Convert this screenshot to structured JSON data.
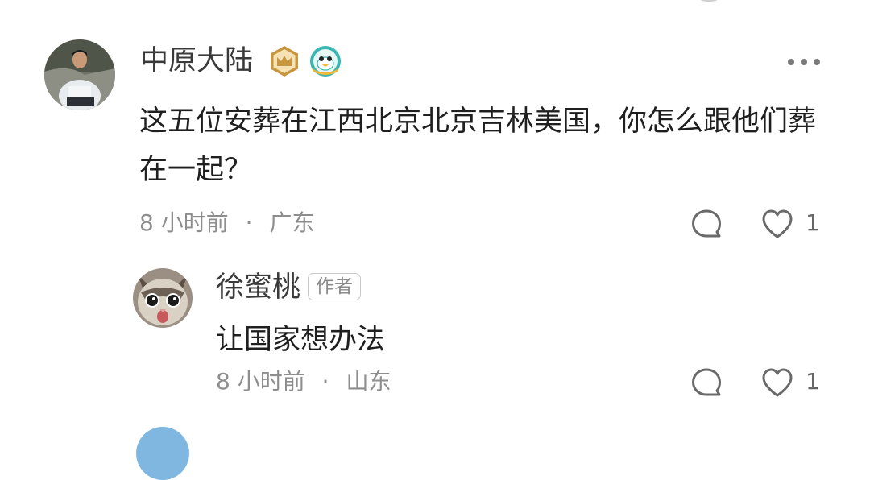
{
  "comments": [
    {
      "user_name": "中原大陆",
      "text": "这五位安葬在江西北京北京吉林美国，你怎么跟他们葬在一起？",
      "time": "8 小时前",
      "location": "广东",
      "likes": "1"
    }
  ],
  "replies": [
    {
      "user_name": "徐蜜桃",
      "badge": "作者",
      "text": "让国家想办法",
      "time": "8 小时前",
      "location": "山东",
      "likes": "1"
    }
  ],
  "meta_separator": "·",
  "colors": {
    "meta_text": "#8e8e8e",
    "badge_gold": "#c8963e",
    "badge_teal": "#3cb6b0",
    "next_avatar": "#7fb7e0"
  },
  "icons": [
    "more-options-icon",
    "comment-bubble-icon",
    "heart-icon",
    "crown-badge-icon",
    "bird-badge-icon"
  ]
}
